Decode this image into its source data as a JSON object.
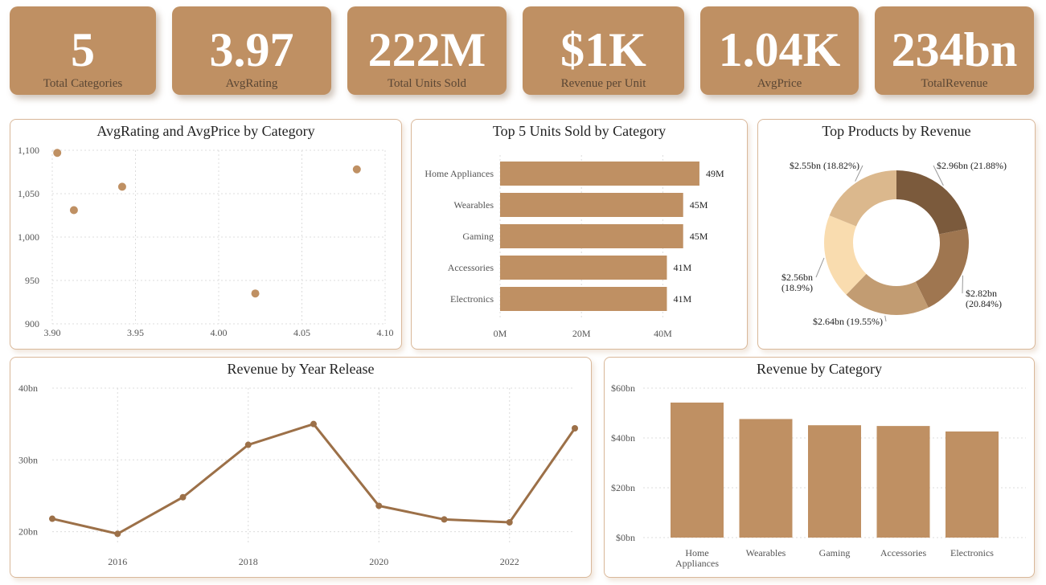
{
  "kpis": [
    {
      "value": "5",
      "label": "Total Categories"
    },
    {
      "value": "3.97",
      "label": "AvgRating"
    },
    {
      "value": "222M",
      "label": "Total Units Sold"
    },
    {
      "value": "$1K",
      "label": "Revenue per Unit"
    },
    {
      "value": "1.04K",
      "label": "AvgPrice"
    },
    {
      "value": "234bn",
      "label": "TotalRevenue"
    }
  ],
  "colors": {
    "bar": "#bf9063",
    "line": "#9c7048",
    "accent": "#bf9063"
  },
  "chart_data": [
    {
      "type": "scatter",
      "title": "AvgRating and AvgPrice by Category",
      "xlim": [
        3.9,
        4.1
      ],
      "ylim": [
        900,
        1100
      ],
      "xticks": [
        "3.90",
        "3.95",
        "4.00",
        "4.05",
        "4.10"
      ],
      "yticks": [
        "1,100",
        "1,050",
        "1,000",
        "950",
        "900"
      ],
      "points": [
        {
          "x": 3.903,
          "y": 1097
        },
        {
          "x": 3.913,
          "y": 1031
        },
        {
          "x": 3.942,
          "y": 1058
        },
        {
          "x": 4.022,
          "y": 935
        },
        {
          "x": 4.083,
          "y": 1078
        }
      ]
    },
    {
      "type": "bar",
      "orientation": "horizontal",
      "title": "Top 5 Units Sold by Category",
      "categories": [
        "Home Appliances",
        "Wearables",
        "Gaming",
        "Accessories",
        "Electronics"
      ],
      "values": [
        49,
        45,
        45,
        41,
        41
      ],
      "labels": [
        "49M",
        "45M",
        "45M",
        "41M",
        "41M"
      ],
      "xlim": [
        0,
        50
      ],
      "xticks": [
        "0M",
        "20M",
        "40M"
      ]
    },
    {
      "type": "pie",
      "donut": true,
      "title": "Top Products by Revenue",
      "slices": [
        {
          "value": 2.96,
          "label": [
            "$2.96bn (21.88%)"
          ],
          "color": "#7b5a3c"
        },
        {
          "value": 2.82,
          "label": [
            "$2.82bn",
            "(20.84%)"
          ],
          "color": "#9f7650"
        },
        {
          "value": 2.64,
          "label": [
            "$2.64bn (19.55%)"
          ],
          "color": "#c29c72"
        },
        {
          "value": 2.56,
          "label": [
            "$2.56bn",
            "(18.9%)"
          ],
          "color": "#f9dcaf"
        },
        {
          "value": 2.55,
          "label": [
            "$2.55bn (18.82%)"
          ],
          "color": "#dbb88d"
        }
      ]
    },
    {
      "type": "line",
      "title": "Revenue by Year Release",
      "x": [
        2015,
        2016,
        2017,
        2018,
        2019,
        2020,
        2021,
        2022,
        2023
      ],
      "values": [
        21.8,
        19.7,
        24.8,
        32.1,
        35.0,
        23.6,
        21.7,
        21.3,
        34.4
      ],
      "xticks": [
        "2016",
        "2018",
        "2020",
        "2022"
      ],
      "yticks": [
        "40bn",
        "30bn",
        "20bn"
      ],
      "ylim": [
        18.5,
        40
      ]
    },
    {
      "type": "bar",
      "title": "Revenue by Category",
      "categories": [
        [
          "Home",
          "Appliances"
        ],
        [
          "Wearables"
        ],
        [
          "Gaming"
        ],
        [
          "Accessories"
        ],
        [
          "Electronics"
        ]
      ],
      "values": [
        54.2,
        47.6,
        45.1,
        44.8,
        42.6
      ],
      "yticks": [
        "$60bn",
        "$40bn",
        "$20bn",
        "$0bn"
      ],
      "ylim": [
        0,
        60
      ]
    }
  ]
}
